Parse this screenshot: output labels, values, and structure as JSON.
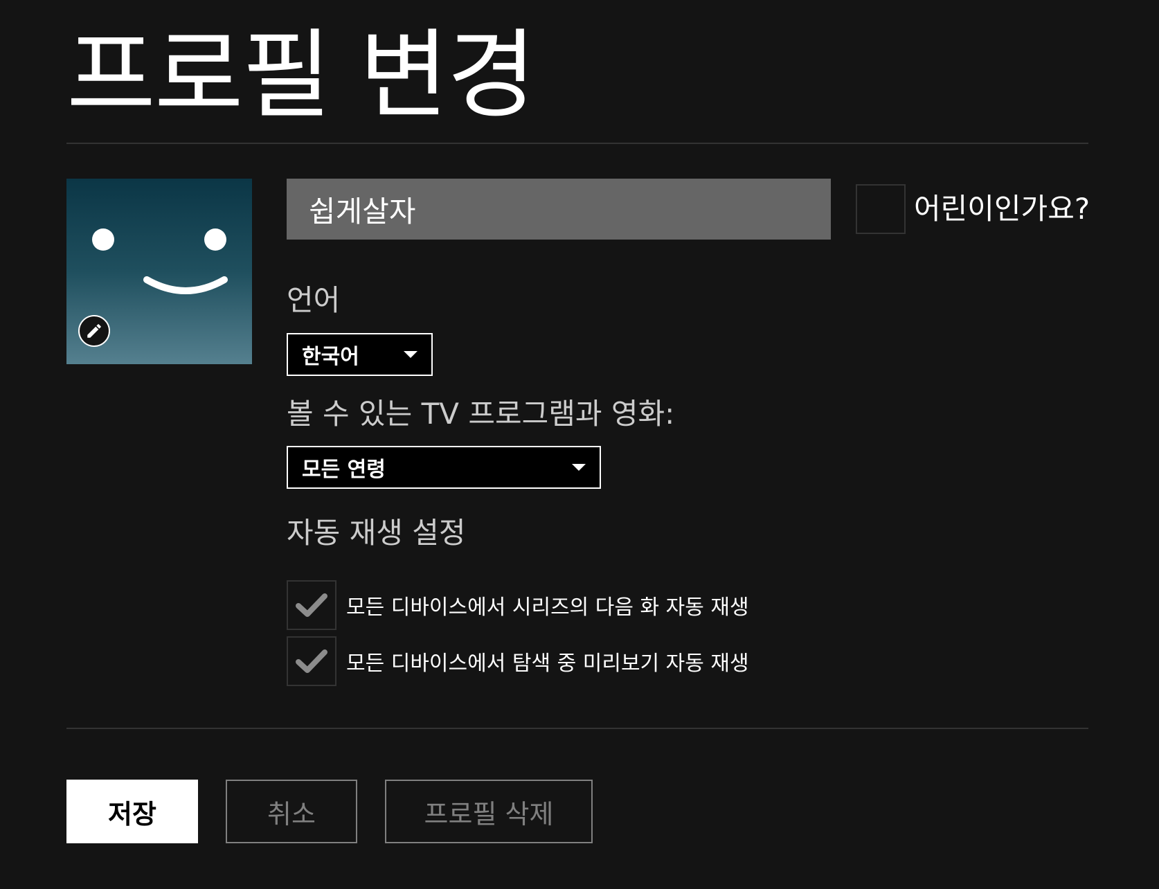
{
  "page": {
    "title": "프로필 변경"
  },
  "profile": {
    "name": "쉽게살자",
    "kids_label": "어린이인가요?",
    "kids_checked": false
  },
  "language": {
    "label": "언어",
    "selected": "한국어"
  },
  "maturity": {
    "label": "볼 수 있는 TV 프로그램과 영화:",
    "selected": "모든 연령"
  },
  "autoplay": {
    "label": "자동 재생 설정",
    "options": [
      {
        "text": "모든 디바이스에서 시리즈의 다음 화 자동 재생",
        "checked": true
      },
      {
        "text": "모든 디바이스에서 탐색 중 미리보기 자동 재생",
        "checked": true
      }
    ]
  },
  "buttons": {
    "save": "저장",
    "cancel": "취소",
    "delete": "프로필 삭제"
  },
  "icons": {
    "avatar": "smiley-avatar-icon",
    "edit": "pencil-icon",
    "dropdown": "caret-down-icon",
    "check": "check-icon"
  },
  "colors": {
    "background": "#141414",
    "input_bg": "#666666",
    "divider": "#333333",
    "muted": "#808080",
    "avatar_top": "#0b3646",
    "avatar_bottom": "#55808f"
  }
}
